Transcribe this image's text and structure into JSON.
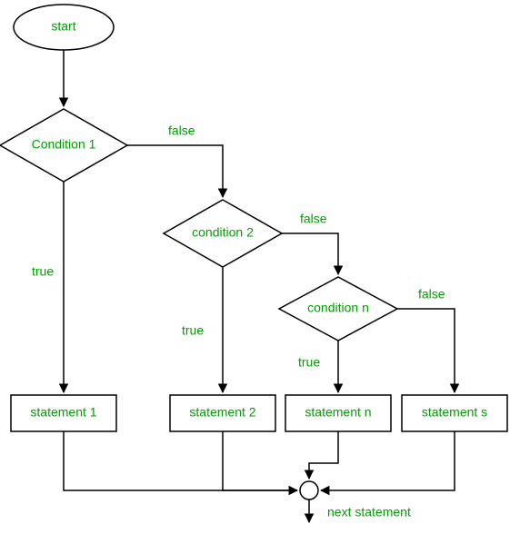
{
  "flowchart": {
    "start": "start",
    "cond1": "Condition 1",
    "cond2": "condition 2",
    "condn": "condition n",
    "stmt1": "statement 1",
    "stmt2": "statement 2",
    "stmtn": "statement n",
    "stmts": "statement s",
    "next": "next statement",
    "true": "true",
    "false": "false"
  }
}
